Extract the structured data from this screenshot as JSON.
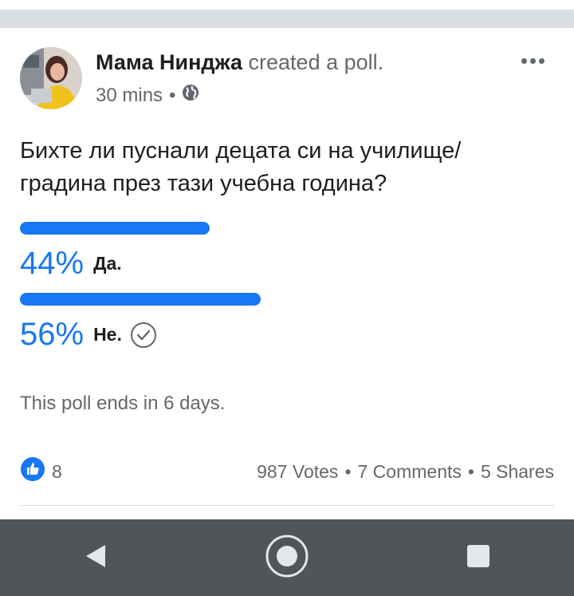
{
  "post": {
    "author_name": "Мама Нинджа",
    "action_text": "created a poll.",
    "timestamp": "30 mins",
    "privacy_icon": "globe-icon",
    "more_icon": "more-icon",
    "question": "Бихте ли пуснали децата си на училище/ градина през тази учебна година?"
  },
  "poll": {
    "accent_color": "#1877f2",
    "options": [
      {
        "percent_label": "44%",
        "label": "Да.",
        "fraction": 0.44,
        "selected": false
      },
      {
        "percent_label": "56%",
        "label": "Не.",
        "fraction": 0.56,
        "selected": true
      }
    ],
    "ends_text": "This poll ends in 6 days."
  },
  "engagement": {
    "like_icon": "like-icon",
    "like_count": "8",
    "votes": "987 Votes",
    "comments": "7 Comments",
    "shares": "5 Shares",
    "separator": "•"
  },
  "nav": {
    "back_icon": "back-icon",
    "home_icon": "home-icon",
    "recents_icon": "recents-icon"
  }
}
